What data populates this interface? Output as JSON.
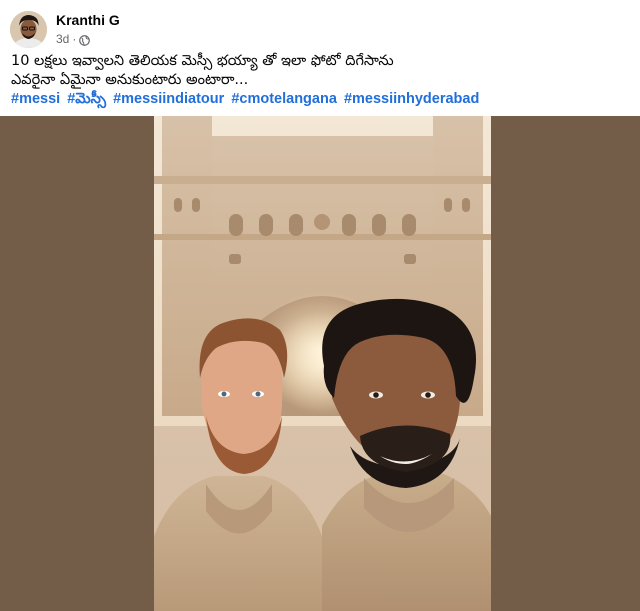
{
  "post": {
    "author": "Kranthi G",
    "time": "3d",
    "separator": "·",
    "privacy_icon": "globe-icon",
    "caption_line1": "10 లక్షలు ఇవ్వాలని తెలియక మెస్సీ భయ్యా తో ఇలా ఫోటో దిగేసాను",
    "caption_line2": "ఎవరైనా ఏమైనా అనుకుంటారు అంటారా...",
    "hashtags": [
      "#messi",
      "#మెస్సీ",
      "#messiindiatour",
      "#cmotelangana",
      "#messiinhyderabad"
    ]
  },
  "colors": {
    "hashtag": "#216fdb",
    "media_background": "#735c48",
    "author_text": "#050505",
    "meta_text": "#65676b"
  }
}
